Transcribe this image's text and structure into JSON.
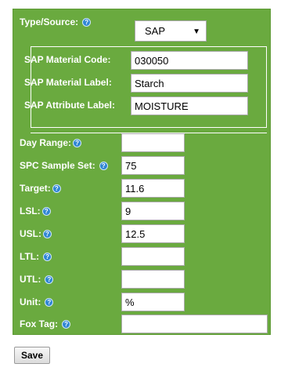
{
  "type_source": {
    "label": "Type/Source:",
    "selected": "SAP",
    "help_icon": "help-icon"
  },
  "sap": {
    "material_code": {
      "label": "SAP Material Code:",
      "value": "030050"
    },
    "material_label": {
      "label": "SAP Material Label:",
      "value": "Starch"
    },
    "attribute_label": {
      "label": "SAP Attribute Label:",
      "value": "MOISTURE"
    }
  },
  "fields": {
    "day_range": {
      "label": "Day Range:",
      "value": ""
    },
    "spc_sample_set": {
      "label": "SPC Sample Set:",
      "value": "75"
    },
    "target": {
      "label": "Target:",
      "value": "11.6"
    },
    "lsl": {
      "label": "LSL:",
      "value": "9"
    },
    "usl": {
      "label": "USL:",
      "value": "12.5"
    },
    "ltl": {
      "label": "LTL:",
      "value": ""
    },
    "utl": {
      "label": "UTL:",
      "value": ""
    },
    "unit": {
      "label": "Unit:",
      "value": "%"
    },
    "fox_tag": {
      "label": "Fox Tag:",
      "value": ""
    }
  },
  "save_label": "Save",
  "colors": {
    "panel": "#6aaa3f",
    "help_icon": "#2f86d3",
    "label_text": "#ffffff"
  }
}
